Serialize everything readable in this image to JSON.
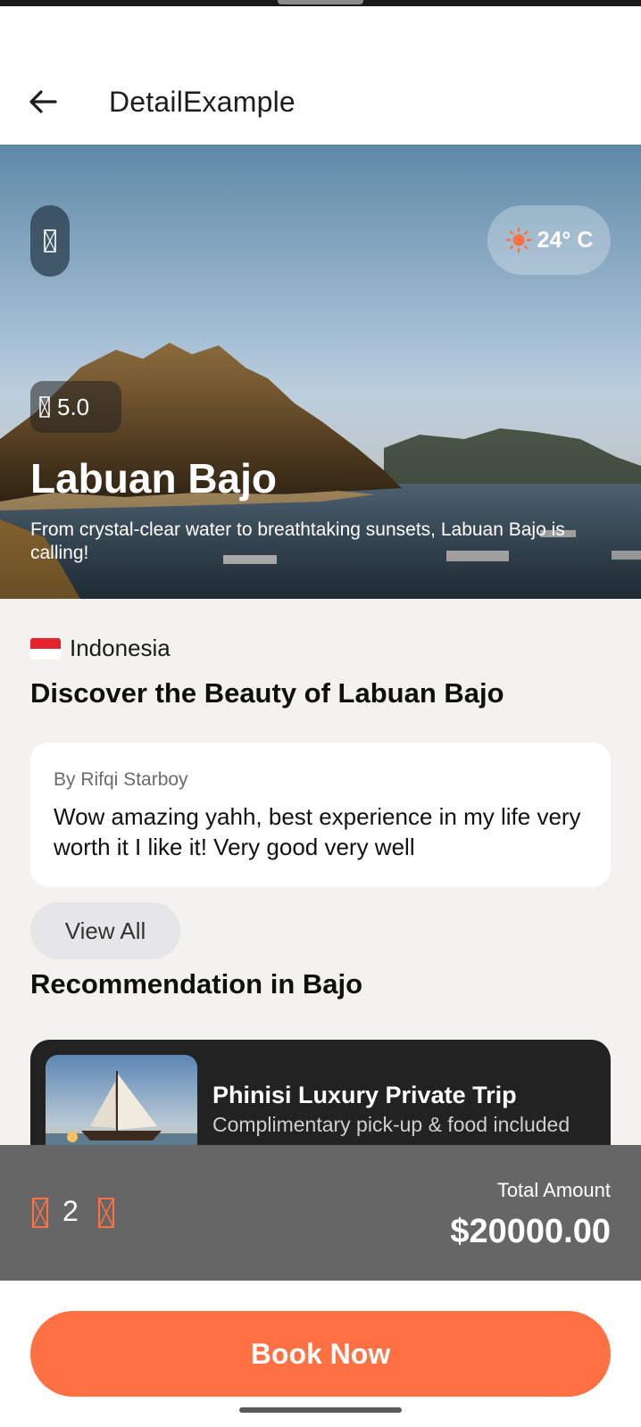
{
  "app_bar": {
    "title": "DetailExample"
  },
  "hero": {
    "weather": "24° C",
    "rating": "5.0",
    "title": "Labuan Bajo",
    "subtitle": "From crystal-clear water to breathtaking sunsets, Labuan Bajo is calling!"
  },
  "content": {
    "country": "Indonesia",
    "heading": "Discover the Beauty of Labuan Bajo",
    "review": {
      "author": "By Rifqi Starboy",
      "text": "Wow amazing yahh, best experience in my life very worth it I like it! Very good very well"
    },
    "view_all": "View All",
    "recommendation_heading": "Recommendation in Bajo",
    "recommendation": {
      "title": "Phinisi Luxury Private Trip",
      "subtitle": "Complimentary pick-up & food included"
    }
  },
  "order": {
    "quantity": "2",
    "total_label": "Total Amount",
    "total_amount": "$20000.00"
  },
  "book_button": "Book Now",
  "colors": {
    "accent": "#ff7043",
    "bottom_bar": "#666666",
    "content_bg": "#f3f2ef",
    "card_dark": "#222222"
  }
}
